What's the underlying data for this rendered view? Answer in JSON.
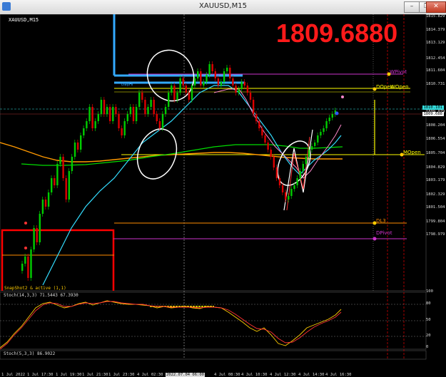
{
  "window": {
    "title": "XAUUSD,M15",
    "minimize_label": "–",
    "restore_label": "❐",
    "close_label": "✕"
  },
  "chart": {
    "symbol_label": "XAUUSD,M15",
    "big_price": "1809.6880",
    "current_price": "1810.101",
    "current_price2": "1809.688",
    "line_labels": {
      "wpivot": "WPivot",
      "dopen": "DOpen",
      "wopen": "WOpen",
      "mopen": "MOpen",
      "dl3": "DL3",
      "dpivot": "DPivot",
      "dayhi": "DayHi"
    },
    "price_axis": [
      "1815.829",
      "1814.379",
      "1813.129",
      "1812.454",
      "1811.604",
      "1810.731",
      "1809.079",
      "1808.204",
      "1806.554",
      "1805.704",
      "1804.829",
      "1803.179",
      "1802.329",
      "1801.504",
      "1799.804",
      "1798.979"
    ],
    "time_axis": [
      "1 Jul 2022",
      "1 Jul 17:30",
      "1 Jul 19:30",
      "1 Jul 21:30",
      "1 Jul 23:30",
      "4 Jul 02:30",
      "4 Jul 06:30",
      "2022.07.04 06:00",
      "4 Jul 08:30",
      "4 Jul 10:30",
      "4 Jul 12:30",
      "4 Jul 14:30",
      "4 Jul 16:30"
    ],
    "snapshot_label": "SnapShot2 & active (1,1)",
    "stoch1_label": "Stoch(14,3,3) 71.5443 67.3930",
    "stoch2_label": "Stoch(5,3,3) 86.9022",
    "stoch_levels": [
      "80",
      "50",
      "20"
    ],
    "stoch_axis": [
      "100",
      "80",
      "50",
      "20",
      "0"
    ]
  },
  "colors": {
    "background": "#000000",
    "bull": "#00cc00",
    "bear": "#dd0000",
    "big_price": "#ff1a1a",
    "wpivot": "#cc33cc",
    "dopen": "#ffff00",
    "dl3": "#ff8c00",
    "dayhi": "#33aaff",
    "ma_fast": "#33ddff",
    "ma_slow": "#00dd00",
    "ma_orange": "#ff9900",
    "stoch_main": "#ffcc00",
    "stoch_signal": "#ff3333"
  }
}
